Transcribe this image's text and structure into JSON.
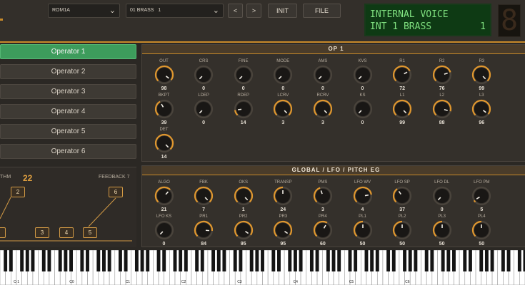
{
  "toolbar": {
    "bank": "ROM1A",
    "voice": "01 BRASS   1",
    "prev_label": "<",
    "next_label": ">",
    "init_label": "INIT",
    "file_label": "FILE",
    "chevron_icon": "chevron-down-icon"
  },
  "lcd": {
    "line1": "INTERNAL VOICE",
    "line2a": "INT 1 BRASS",
    "line2b": "1"
  },
  "seg_digit": "8",
  "operators": [
    "Operator 1",
    "Operator 2",
    "Operator 3",
    "Operator 4",
    "Operator 5",
    "Operator 6"
  ],
  "selected_operator": 0,
  "algorithm": {
    "label": "THM",
    "value": "22",
    "feedback_label": "FEEDBACK 7",
    "boxes": [
      "2",
      "6",
      "3",
      "4",
      "5"
    ]
  },
  "op_panel": {
    "title": "OP 1",
    "knobs": [
      {
        "label": "OUT",
        "value": "98",
        "level": 0.97
      },
      {
        "label": "CRS",
        "value": "0",
        "level": 0.0
      },
      {
        "label": "FINE",
        "value": "0",
        "level": 0.0
      },
      {
        "label": "MODE",
        "value": "0",
        "level": 0.0
      },
      {
        "label": "AMS",
        "value": "0",
        "level": 0.0
      },
      {
        "label": "KVS",
        "value": "0",
        "level": 0.0
      },
      {
        "label": "R1",
        "value": "72",
        "level": 0.73
      },
      {
        "label": "R2",
        "value": "76",
        "level": 0.77
      },
      {
        "label": "R3",
        "value": "99",
        "level": 1.0
      },
      {
        "label": "BKPT",
        "value": "39",
        "level": 0.39
      },
      {
        "label": "LDEP",
        "value": "0",
        "level": 0.0
      },
      {
        "label": "RDEP",
        "value": "14",
        "level": 0.14
      },
      {
        "label": "LCRV",
        "value": "3",
        "level": 1.0
      },
      {
        "label": "RCRV",
        "value": "3",
        "level": 1.0
      },
      {
        "label": "KS",
        "value": "0",
        "level": 0.0
      },
      {
        "label": "L1",
        "value": "99",
        "level": 1.0
      },
      {
        "label": "L2",
        "value": "88",
        "level": 0.89
      },
      {
        "label": "L3",
        "value": "96",
        "level": 0.97
      },
      {
        "label": "DET",
        "value": "14",
        "level": 1.0
      }
    ]
  },
  "global_panel": {
    "title": "GLOBAL  /  LFO  /  PITCH EG",
    "knobs": [
      {
        "label": "ALGO",
        "value": "21",
        "level": 0.66
      },
      {
        "label": "FBK",
        "value": "7",
        "level": 1.0
      },
      {
        "label": "OKS",
        "value": "1",
        "level": 1.0
      },
      {
        "label": "TRANSP",
        "value": "24",
        "level": 0.5
      },
      {
        "label": "PMS",
        "value": "3",
        "level": 0.43
      },
      {
        "label": "LFO WV",
        "value": "4",
        "level": 0.8
      },
      {
        "label": "LFO SP",
        "value": "37",
        "level": 0.37
      },
      {
        "label": "LFO DL",
        "value": "0",
        "level": 0.0
      },
      {
        "label": "LFO PM",
        "value": "5",
        "level": 0.05
      },
      {
        "label": "LFO KS",
        "value": "0",
        "level": 0.0
      },
      {
        "label": "PR1",
        "value": "84",
        "level": 0.85
      },
      {
        "label": "PR2",
        "value": "95",
        "level": 0.96
      },
      {
        "label": "PR3",
        "value": "95",
        "level": 0.96
      },
      {
        "label": "PR4",
        "value": "60",
        "level": 0.61
      },
      {
        "label": "PL1",
        "value": "50",
        "level": 0.5
      },
      {
        "label": "PL2",
        "value": "50",
        "level": 0.5
      },
      {
        "label": "PL3",
        "value": "50",
        "level": 0.5
      },
      {
        "label": "PL4",
        "value": "50",
        "level": 0.5
      }
    ]
  },
  "keyboard_labels": [
    "C-1",
    "C0",
    "C1",
    "C2",
    "C3",
    "C4",
    "C5",
    "C6"
  ]
}
